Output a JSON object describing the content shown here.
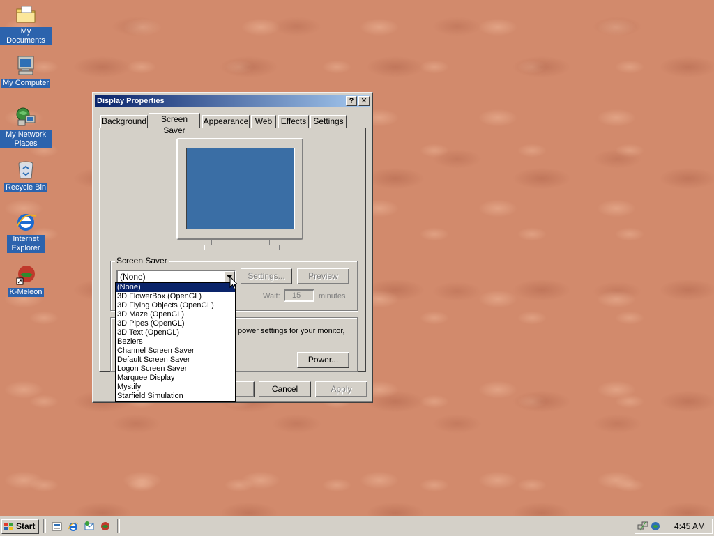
{
  "desktop": {
    "icons": [
      {
        "label": "My Documents",
        "icon": "folder-icon"
      },
      {
        "label": "My Computer",
        "icon": "computer-icon"
      },
      {
        "label": "My Network Places",
        "icon": "network-icon"
      },
      {
        "label": "Recycle Bin",
        "icon": "recycle-bin-icon"
      },
      {
        "label": "Internet Explorer",
        "icon": "internet-explorer-icon"
      },
      {
        "label": "K-Meleon",
        "icon": "k-meleon-icon"
      }
    ]
  },
  "window": {
    "title": "Display Properties",
    "help_button": "?",
    "close_button": "✕",
    "tabs": [
      "Background",
      "Screen Saver",
      "Appearance",
      "Web",
      "Effects",
      "Settings"
    ],
    "active_tab": "Screen Saver",
    "screen_saver_group": {
      "legend": "Screen Saver",
      "selected": "(None)",
      "settings_button": "Settings...",
      "preview_button": "Preview",
      "wait_label": "Wait:",
      "wait_value": "15",
      "minutes_label": "minutes"
    },
    "power_group": {
      "text": "power settings for your monitor,",
      "power_button": "Power..."
    },
    "dropdown_options": [
      "(None)",
      "3D FlowerBox (OpenGL)",
      "3D Flying Objects (OpenGL)",
      "3D Maze (OpenGL)",
      "3D Pipes (OpenGL)",
      "3D Text (OpenGL)",
      "Beziers",
      "Channel Screen Saver",
      "Default Screen Saver",
      "Logon Screen Saver",
      "Marquee Display",
      "Mystify",
      "Starfield Simulation"
    ],
    "buttons": {
      "cancel": "Cancel",
      "apply": "Apply"
    }
  },
  "taskbar": {
    "start_label": "Start",
    "quick_launch": [
      "show-desktop-icon",
      "internet-explorer-icon",
      "outlook-express-icon",
      "k-meleon-icon"
    ],
    "tray_icons": [
      "network-connection-icon",
      "volume-icon"
    ],
    "clock": "4:45 AM"
  },
  "colors": {
    "desktop": "#d28a6c",
    "title_bar_start": "#0a246a",
    "title_bar_end": "#a6caf0",
    "window_face": "#d4d0c8",
    "selection": "#0a246a",
    "monitor_screen": "#3a6ea5"
  }
}
